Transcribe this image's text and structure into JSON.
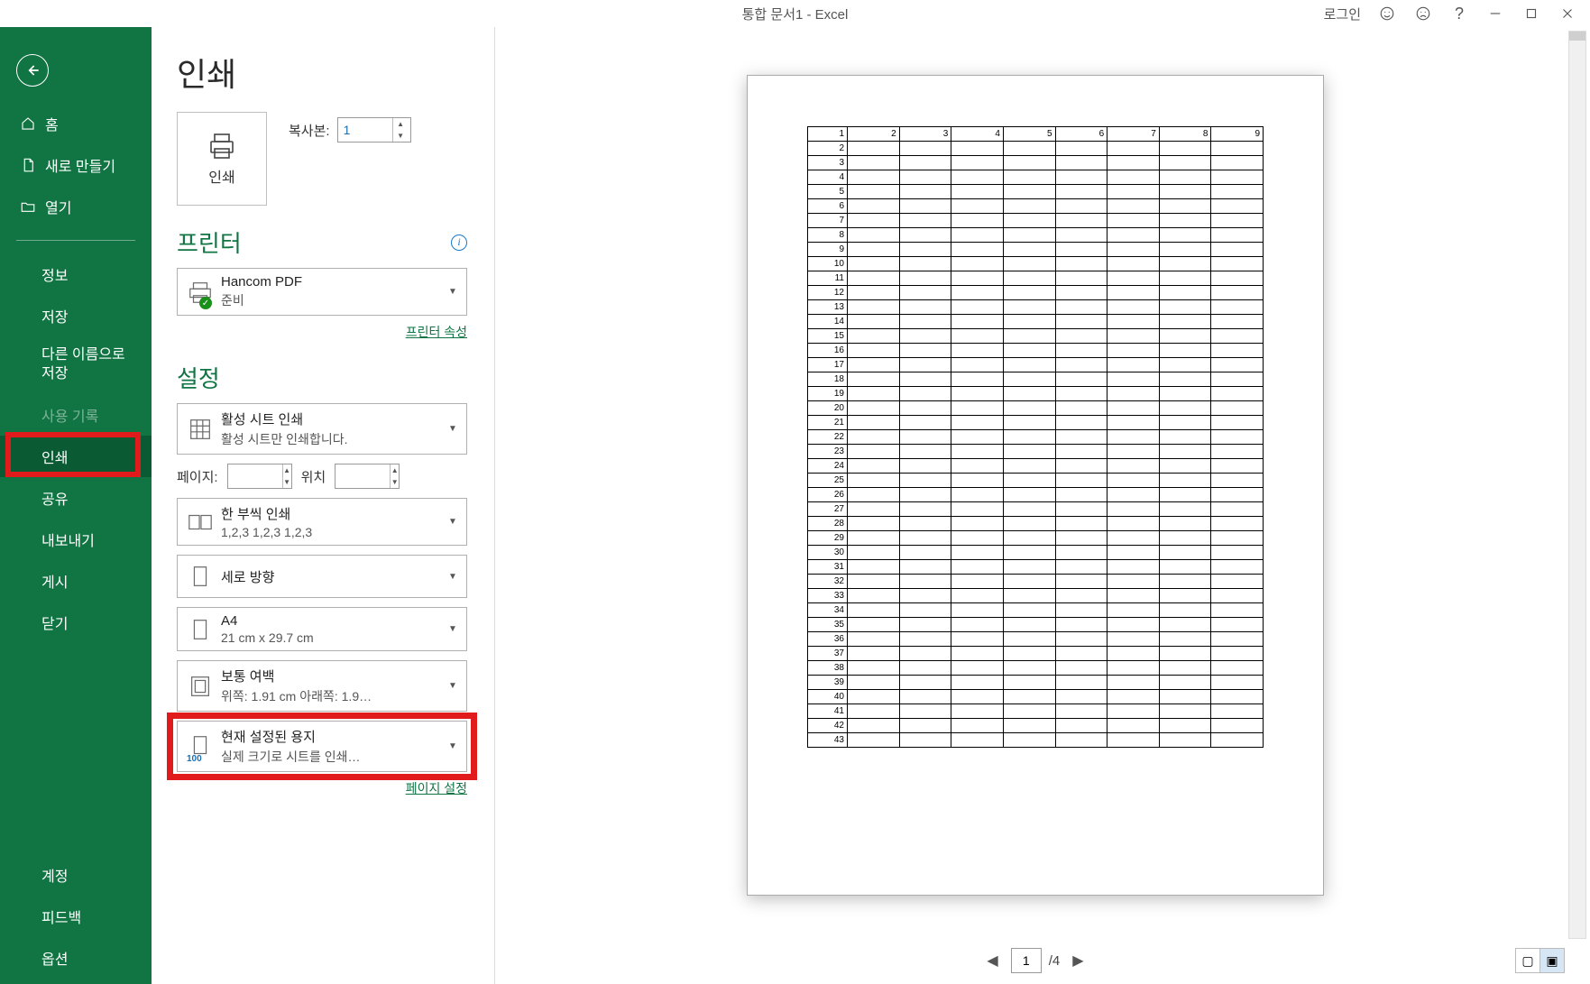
{
  "titlebar": {
    "title": "통합 문서1  -  Excel",
    "login": "로그인"
  },
  "sidebar": {
    "home": "홈",
    "new": "새로 만들기",
    "open": "열기",
    "info": "정보",
    "save": "저장",
    "saveas": "다른 이름으로 저장",
    "history": "사용 기록",
    "print": "인쇄",
    "share": "공유",
    "export": "내보내기",
    "publish": "게시",
    "close": "닫기",
    "account": "계정",
    "feedback": "피드백",
    "options": "옵션"
  },
  "print": {
    "heading": "인쇄",
    "print_button": "인쇄",
    "copies_label": "복사본:",
    "copies_value": "1",
    "printer_header": "프린터",
    "printer_name": "Hancom PDF",
    "printer_status": "준비",
    "printer_props": "프린터 속성",
    "settings_header": "설정",
    "dd_sheets_l1": "활성 시트 인쇄",
    "dd_sheets_l2": "활성 시트만 인쇄합니다.",
    "pages_label": "페이지:",
    "pages_to_label": "위치",
    "dd_collate_l1": "한 부씩 인쇄",
    "dd_collate_l2": "1,2,3    1,2,3    1,2,3",
    "dd_orient": "세로 방향",
    "dd_paper_l1": "A4",
    "dd_paper_l2": "21 cm x 29.7 cm",
    "dd_margin_l1": "보통 여백",
    "dd_margin_l2": "위쪽: 1.91 cm 아래쪽: 1.9…",
    "dd_scale_l1": "현재 설정된 용지",
    "dd_scale_l2": "실제 크기로 시트를 인쇄…",
    "page_setup": "페이지 설정"
  },
  "preview": {
    "cols": [
      "1",
      "2",
      "3",
      "4",
      "5",
      "6",
      "7",
      "8",
      "9"
    ],
    "rows": 43,
    "current_page": "1",
    "total_pages": "/4"
  }
}
